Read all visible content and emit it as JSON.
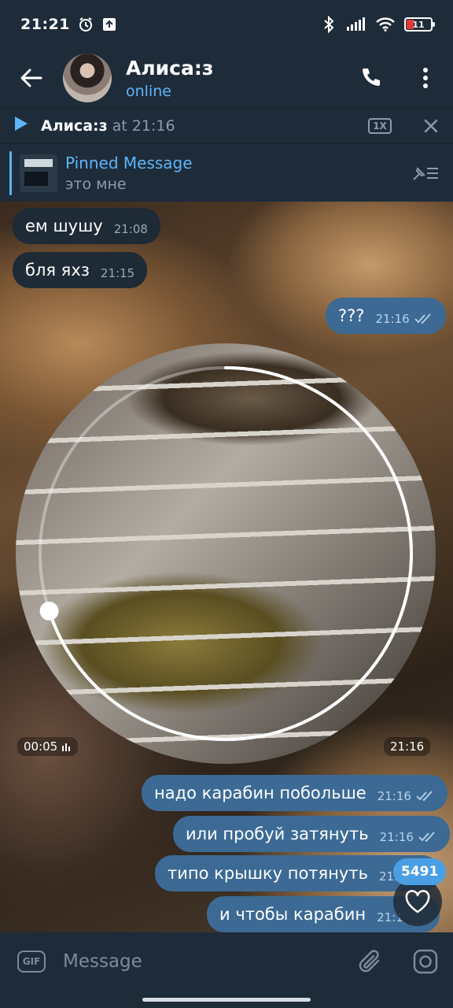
{
  "status_bar": {
    "time": "21:21",
    "battery": "11",
    "icons": [
      "alarm-icon",
      "upload-icon",
      "bluetooth-icon",
      "signal-icon",
      "wifi-icon",
      "battery-icon"
    ]
  },
  "header": {
    "name": "Алиса:з",
    "status": "online"
  },
  "player": {
    "name": "Алиса:з",
    "at": "at 21:16",
    "speed": "1X"
  },
  "pinned": {
    "title": "Pinned Message",
    "text": "это мне"
  },
  "messages": [
    {
      "dir": "in",
      "text": "ем шушу",
      "time": "21:08"
    },
    {
      "dir": "in",
      "text": "бля яхз",
      "time": "21:15"
    },
    {
      "dir": "out",
      "text": "???",
      "time": "21:16"
    },
    {
      "dir": "out",
      "text": "надо карабин побольше",
      "time": "21:16"
    },
    {
      "dir": "out",
      "text": "или пробуй затянуть",
      "time": "21:16"
    },
    {
      "dir": "out",
      "text": "типо крышку потянуть",
      "time": "21:1"
    },
    {
      "dir": "out",
      "text": "и чтобы карабин",
      "time": "21:1"
    }
  ],
  "video_message": {
    "duration": "00:05",
    "time": "21:16",
    "progress": 0.7
  },
  "reaction": {
    "count": "5491",
    "emoji": "heart-icon"
  },
  "input": {
    "placeholder": "Message",
    "gif_label": "GIF"
  },
  "colors": {
    "accent": "#5eb5f7",
    "bar": "#1e2c3a",
    "out_bubble": "#3c6a94",
    "in_bubble": "#1e2a36"
  }
}
